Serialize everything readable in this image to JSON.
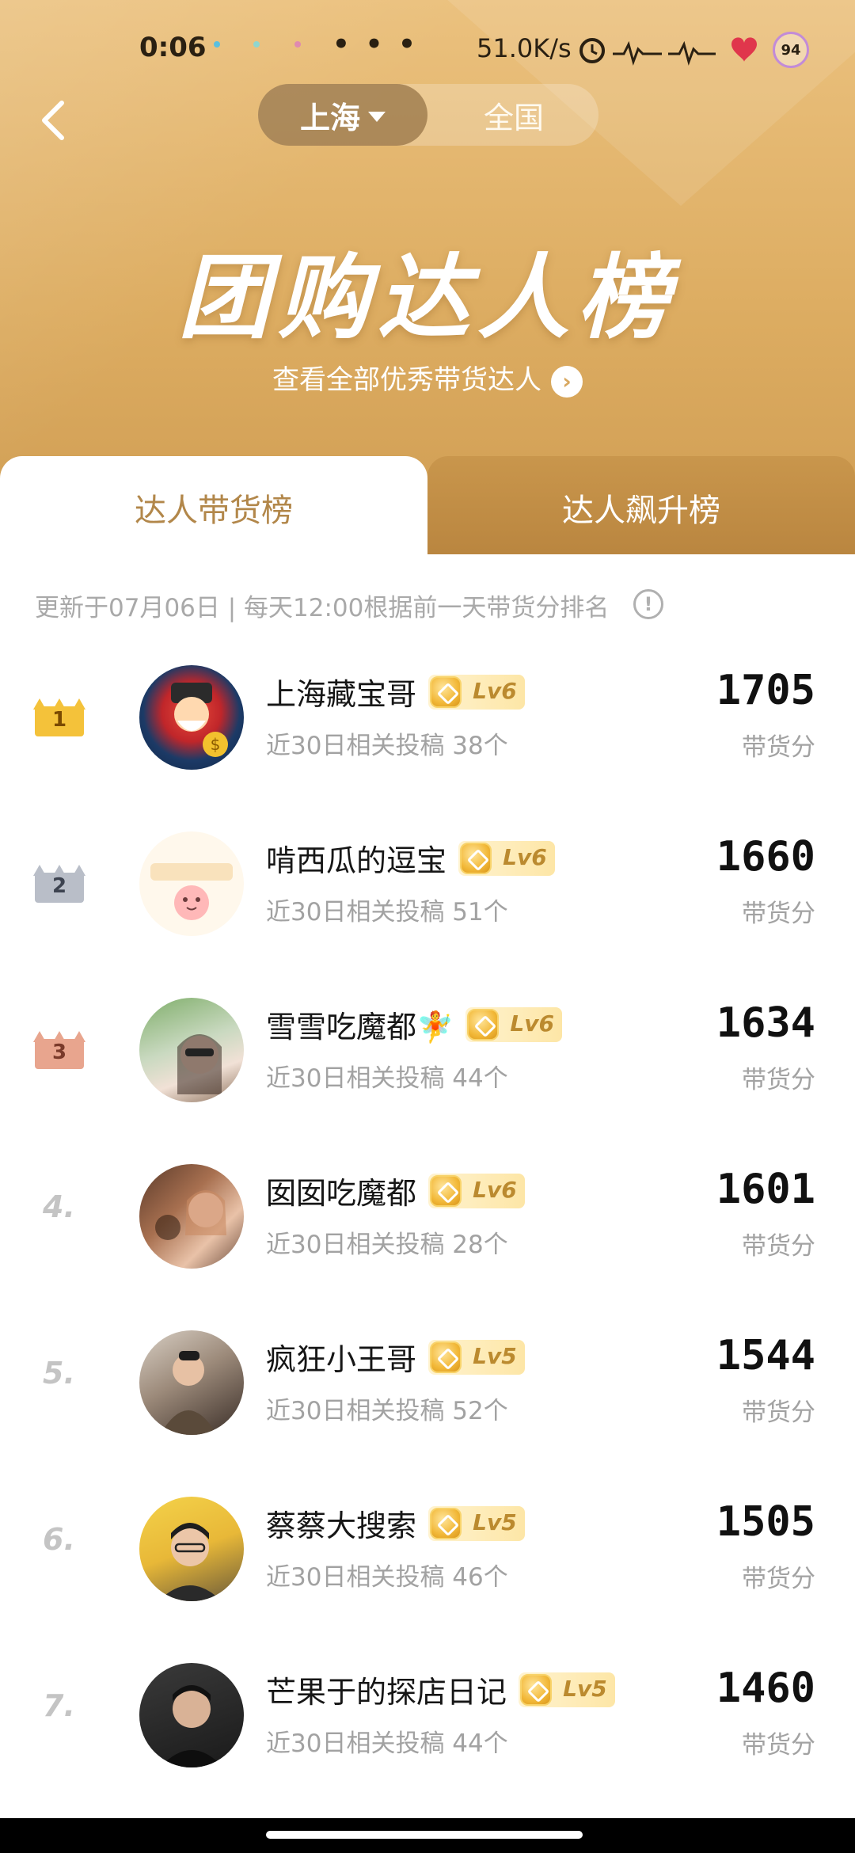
{
  "status_bar": {
    "time": "0:06",
    "more": "• • •",
    "network_speed": "51.0K/s",
    "battery": "94"
  },
  "header": {
    "city_selected": "上海",
    "city_other": "全国",
    "title": "团购达人榜",
    "subtitle_link": "查看全部优秀带货达人",
    "chevron": "›"
  },
  "tabs": [
    {
      "label": "达人带货榜",
      "active": true
    },
    {
      "label": "达人飙升榜",
      "active": false
    }
  ],
  "update_note": "更新于07月06日 | 每天12:00根据前一天带货分排名",
  "info_icon": "!",
  "score_label": "带货分",
  "ranking": [
    {
      "rank": "1",
      "name": "上海藏宝哥",
      "level": "Lv6",
      "posts": "近30日相关投稿 38个",
      "score": "1705",
      "avatar_icon": "cartoon-god-of-wealth-avatar"
    },
    {
      "rank": "2",
      "name": "啃西瓜的逗宝",
      "level": "Lv6",
      "posts": "近30日相关投稿 51个",
      "score": "1660",
      "avatar_icon": "cartoon-avatar"
    },
    {
      "rank": "3",
      "name": "雪雪吃魔都🧚",
      "level": "Lv6",
      "posts": "近30日相关投稿 44个",
      "score": "1634",
      "avatar_icon": "photo-avatar"
    },
    {
      "rank": "4.",
      "name": "囡囡吃魔都",
      "level": "Lv6",
      "posts": "近30日相关投稿 28个",
      "score": "1601",
      "avatar_icon": "photo-avatar"
    },
    {
      "rank": "5.",
      "name": "疯狂小王哥",
      "level": "Lv5",
      "posts": "近30日相关投稿 52个",
      "score": "1544",
      "avatar_icon": "photo-avatar"
    },
    {
      "rank": "6.",
      "name": "蔡蔡大搜索",
      "level": "Lv5",
      "posts": "近30日相关投稿 46个",
      "score": "1505",
      "avatar_icon": "photo-avatar"
    },
    {
      "rank": "7.",
      "name": "芒果于的探店日记",
      "level": "Lv5",
      "posts": "近30日相关投稿 44个",
      "score": "1460",
      "avatar_icon": "photo-avatar"
    }
  ],
  "colors": {
    "gold_header": "#ddad62",
    "tab_active_text": "#b2874a",
    "crown_gold": "#f4c23a",
    "crown_silver": "#b9bec8",
    "crown_bronze": "#e8a58e"
  }
}
